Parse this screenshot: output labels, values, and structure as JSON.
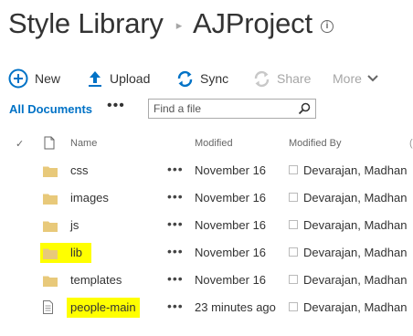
{
  "breadcrumb": {
    "library": "Style Library",
    "separator": "▸",
    "project": "AJProject",
    "info_icon": "i"
  },
  "commands": {
    "new_label": "New",
    "upload_label": "Upload",
    "sync_label": "Sync",
    "share_label": "Share",
    "more_label": "More"
  },
  "view": {
    "label": "All Documents",
    "ellipsis": "•••",
    "search_placeholder": "Find a file"
  },
  "columns": {
    "check": "✓",
    "name": "Name",
    "modified": "Modified",
    "modified_by": "Modified By"
  },
  "rows": [
    {
      "type": "folder",
      "name": "css",
      "dots": "•••",
      "modified": "November 16",
      "modified_by": "Devarajan, Madhan",
      "highlighted": false
    },
    {
      "type": "folder",
      "name": "images",
      "dots": "•••",
      "modified": "November 16",
      "modified_by": "Devarajan, Madhan",
      "highlighted": false
    },
    {
      "type": "folder",
      "name": "js",
      "dots": "•••",
      "modified": "November 16",
      "modified_by": "Devarajan, Madhan",
      "highlighted": false
    },
    {
      "type": "folder",
      "name": "lib",
      "dots": "•••",
      "modified": "November 16",
      "modified_by": "Devarajan, Madhan",
      "highlighted": true
    },
    {
      "type": "folder",
      "name": "templates",
      "dots": "•••",
      "modified": "November 16",
      "modified_by": "Devarajan, Madhan",
      "highlighted": false
    },
    {
      "type": "file",
      "name": "people-main",
      "dots": "•••",
      "modified": "23 minutes ago",
      "modified_by": "Devarajan, Madhan",
      "highlighted": true
    }
  ],
  "colors": {
    "accent": "#0072c6",
    "folder": "#e8c97a",
    "highlight": "#ffff00",
    "disabled": "#a6a6a6"
  },
  "icons": {
    "new": "plus-circle-icon",
    "upload": "upload-arrow-icon",
    "sync": "sync-icon",
    "share": "share-icon",
    "more": "chevron-down-icon",
    "search": "search-icon",
    "folder": "folder-icon",
    "file": "file-icon",
    "doc_header": "document-icon"
  }
}
